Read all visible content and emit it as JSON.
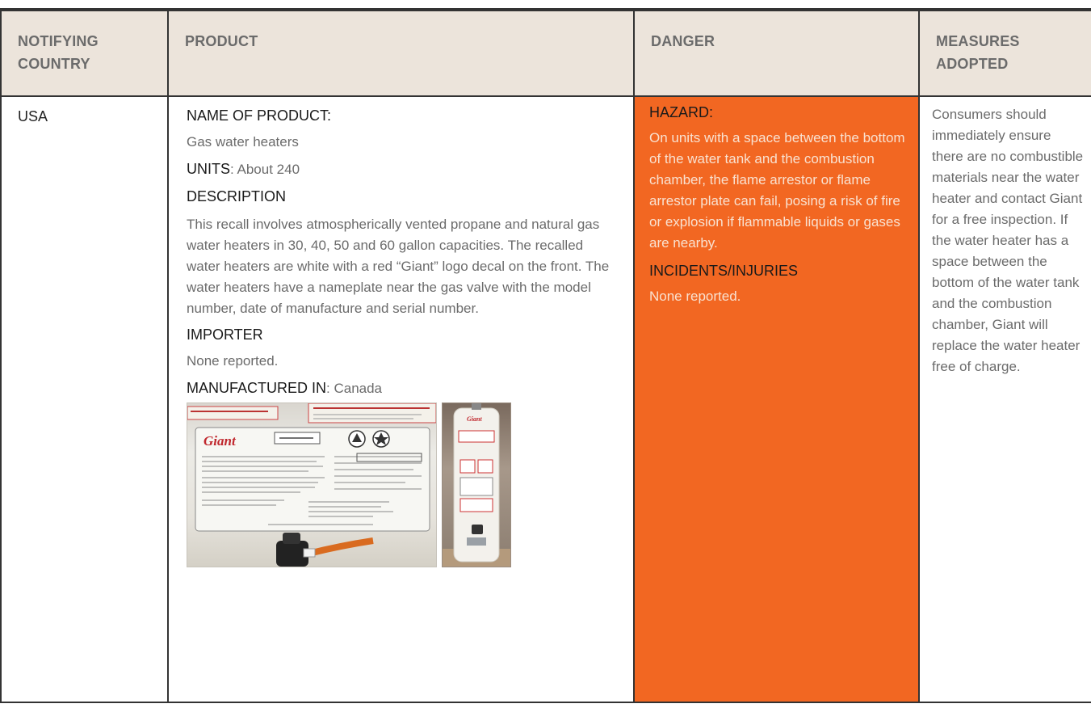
{
  "headers": {
    "country": "NOTIFYING COUNTRY",
    "product": "PRODUCT",
    "danger": "DANGER",
    "measures": "MEASURES ADOPTED"
  },
  "row": {
    "country": "USA",
    "product": {
      "name_label": "NAME OF PRODUCT:",
      "name_value": "Gas water heaters",
      "units_label": "UNITS",
      "units_value": ": About 240",
      "description_label": "DESCRIPTION",
      "description_text": "This recall involves atmospherically vented propane and natural gas water heaters in 30, 40, 50 and 60 gallon capacities. The recalled water heaters are white with a red “Giant” logo decal on the front. The water heaters have a nameplate near the gas valve with the model number, date of manufacture and serial number.",
      "importer_label": "IMPORTER",
      "importer_value": "None reported.",
      "manufactured_label": "MANUFACTURED IN",
      "manufactured_value": ": Canada"
    },
    "danger": {
      "hazard_label": "HAZARD:",
      "hazard_text": "On units with a space between the bottom of the water tank and the combustion chamber, the flame arrestor or flame arrestor plate can fail, posing a risk of fire or explosion if flammable liquids or gases are nearby.",
      "incidents_label": "INCIDENTS/INJURIES",
      "incidents_text": "None reported."
    },
    "measures": "Consumers should immediately ensure there are no combustible materials near the water heater and contact Giant for a free inspection. If the water heater has a space between the bottom of the water tank and the combustion chamber, Giant will replace the water heater free of charge."
  },
  "photos": {
    "nameplate_logo": "Giant",
    "heater_logo": "Giant"
  },
  "colors": {
    "header_bg": "#ece4db",
    "danger_bg": "#f26722",
    "border": "#333333"
  }
}
